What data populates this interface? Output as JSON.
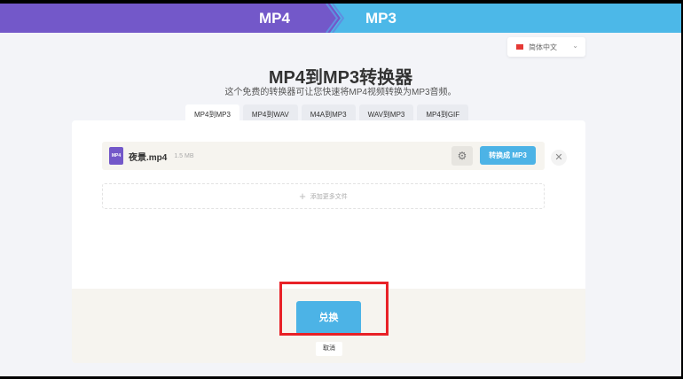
{
  "header": {
    "from": "MP4",
    "to": "MP3",
    "colors": {
      "from": "#7358c9",
      "to": "#4cb8e8"
    }
  },
  "language": {
    "selected": "简体中文"
  },
  "title": "MP4到MP3转换器",
  "subtitle": "这个免费的转换器可让您快速将MP4视频转换为MP3音频。",
  "tabs": [
    {
      "label": "MP4到MP3",
      "active": true
    },
    {
      "label": "MP4到WAV"
    },
    {
      "label": "M4A到MP3"
    },
    {
      "label": "WAV到MP3"
    },
    {
      "label": "MP4到GIF"
    }
  ],
  "file": {
    "icon_label": "MP4",
    "name": "夜景.mp4",
    "size": "1.5 MB",
    "convert_label": "转换成 MP3"
  },
  "add_more": "添加更多文件",
  "convert_button": "兑换",
  "cancel_button": "取消"
}
